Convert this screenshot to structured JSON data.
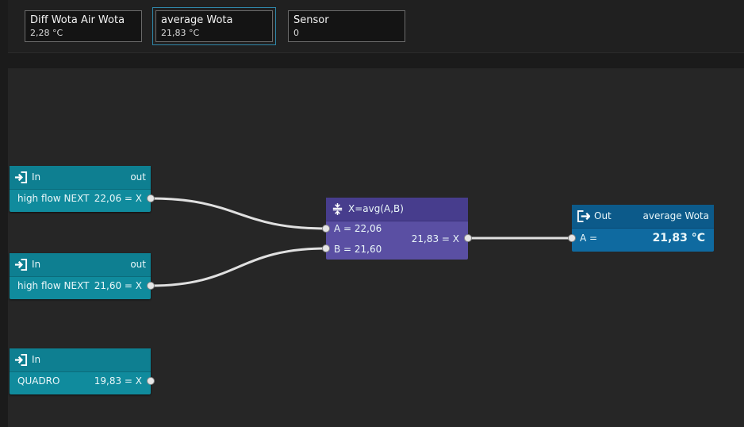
{
  "tiles": [
    {
      "title": "Diff Wota Air Wota",
      "value": "2,28 °C"
    },
    {
      "title": "average Wota",
      "value": "21,83 °C"
    },
    {
      "title": "Sensor",
      "value": "0"
    }
  ],
  "nodes": {
    "in1": {
      "title": "In",
      "out_label": "out",
      "label": "high flow NEXT",
      "value": "22,06 = X"
    },
    "in2": {
      "title": "In",
      "out_label": "out",
      "label": "high flow NEXT",
      "value": "21,60 = X"
    },
    "in3": {
      "title": "In",
      "label": "QUADRO",
      "value": "19,83 = X"
    },
    "avg": {
      "title": "X=avg(A,B)",
      "input_a": "A = 22,06",
      "input_b": "B = 21,60",
      "output": "21,83 = X"
    },
    "out": {
      "title": "Out",
      "name": "average Wota",
      "label": "A =",
      "value": "21,83 °C"
    }
  },
  "icons": {
    "input": "sign-in-icon",
    "output": "sign-out-icon",
    "average": "average-icon"
  },
  "colors": {
    "input_node": "#108b9d",
    "average_node": "#5a4fa3",
    "output_node": "#0f6aa0",
    "selected_outline": "#2f86a8"
  }
}
